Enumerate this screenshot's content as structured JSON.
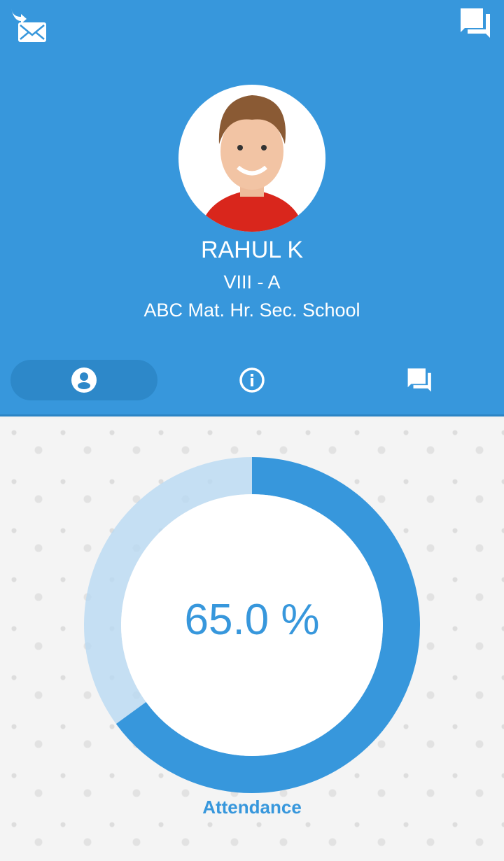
{
  "header": {
    "background_color": "#3797dc",
    "left_icon": "mail-forward-icon",
    "right_icon": "chat-icon"
  },
  "profile": {
    "name": "RAHUL K",
    "class": "VIII - A",
    "school": "ABC Mat. Hr. Sec. School"
  },
  "tabs": [
    {
      "icon": "account-circle-icon",
      "active": true
    },
    {
      "icon": "info-icon",
      "active": false
    },
    {
      "icon": "chat-icon",
      "active": false
    }
  ],
  "attendance": {
    "value_text": "65.0 %",
    "percent": 65.0,
    "label": "Attendance",
    "color": "#3797dc",
    "track_color": "#b9d9f2"
  }
}
